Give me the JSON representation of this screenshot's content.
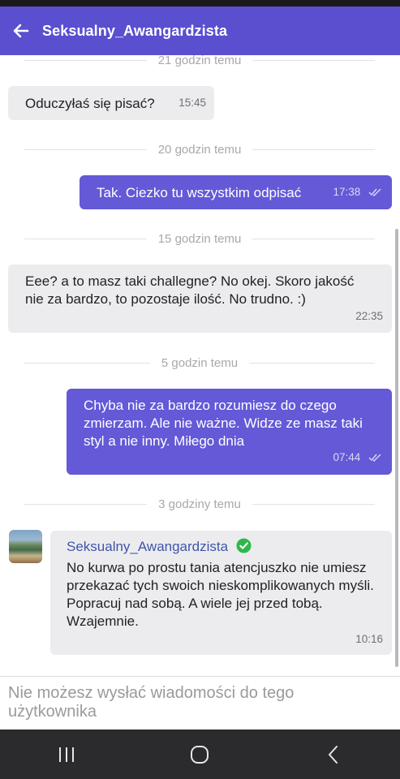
{
  "header": {
    "title": "Seksualny_Awangardzista"
  },
  "dividers": [
    "21 godzin temu",
    "20 godzin temu",
    "15 godzin temu",
    "5 godzin temu",
    "3 godziny temu"
  ],
  "messages": [
    {
      "direction": "incoming",
      "text": "Oduczyłaś się pisać?",
      "time": "15:45"
    },
    {
      "direction": "outgoing",
      "text": "Tak. Ciezko tu wszystkim odpisać",
      "time": "17:38"
    },
    {
      "direction": "incoming",
      "text": "Eee? a to masz taki challegne? No okej. Skoro jakość nie za bardzo, to pozostaje ilość. No trudno. :)",
      "time": "22:35"
    },
    {
      "direction": "outgoing",
      "text": "Chyba nie za bardzo rozumiesz do czego zmierzam. Ale nie ważne. Widze ze masz taki styl a nie inny. Miłego dnia",
      "time": "07:44"
    },
    {
      "direction": "incoming",
      "sender": "Seksualny_Awangardzista",
      "text": "No kurwa po prostu tania atencjuszko nie umiesz przekazać tych swoich nieskomplikowanych myśli. Popracuj nad sobą. A wiele jej przed tobą. Wzajemnie.",
      "time": "10:16"
    }
  ],
  "composer": {
    "disabled_text": "Nie możesz wysłać wiadomości do tego użytkownika"
  },
  "icons": {
    "back": "arrow-left-icon",
    "read": "double-check-icon",
    "verified": "verified-check-icon",
    "nav": [
      "recent-apps-icon",
      "home-icon",
      "nav-back-icon"
    ]
  },
  "colors": {
    "accent": "#5a4fcf",
    "outgoing_bubble": "#6459d6",
    "incoming_bubble": "#ececef",
    "verified": "#2fb84a"
  }
}
